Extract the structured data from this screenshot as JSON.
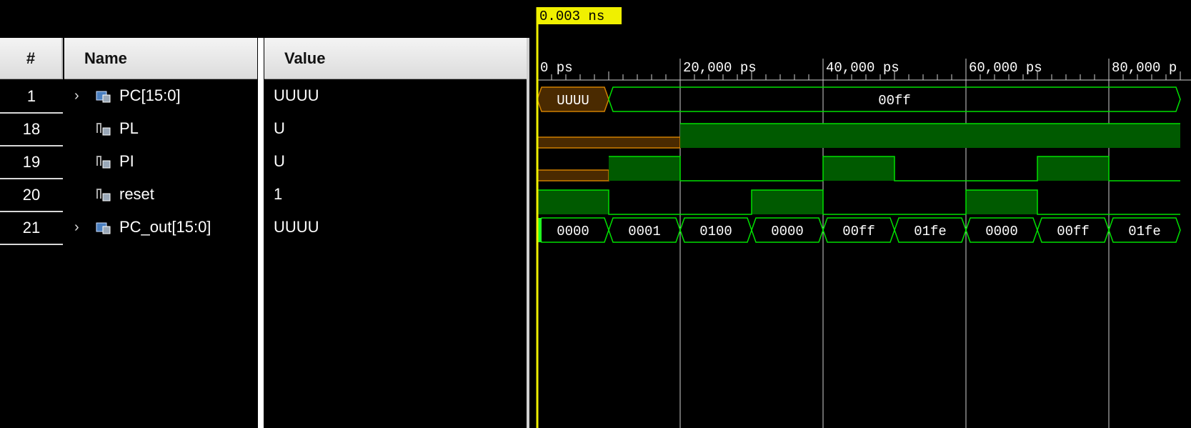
{
  "headers": {
    "num": "#",
    "name": "Name",
    "value": "Value"
  },
  "signals": [
    {
      "num": "1",
      "name": "PC[15:0]",
      "value": "UUUU",
      "expandable": true,
      "icon": "bus-icon"
    },
    {
      "num": "18",
      "name": "PL",
      "value": "U",
      "expandable": false,
      "icon": "signal-icon"
    },
    {
      "num": "19",
      "name": "PI",
      "value": "U",
      "expandable": false,
      "icon": "signal-icon"
    },
    {
      "num": "20",
      "name": "reset",
      "value": "1",
      "expandable": false,
      "icon": "signal-icon"
    },
    {
      "num": "21",
      "name": "PC_out[15:0]",
      "value": "UUUU",
      "expandable": true,
      "icon": "bus-icon"
    }
  ],
  "cursor": {
    "label": "0.003 ns",
    "time_ps": 3
  },
  "timeline": {
    "ticks": [
      "0 ps",
      "20,000 ps",
      "40,000 ps",
      "60,000 ps",
      "80,000 p"
    ],
    "tick_values_ps": [
      0,
      20000,
      40000,
      60000,
      80000
    ]
  },
  "waveforms": {
    "PC": [
      {
        "from": 0,
        "to": 10000,
        "label": "UUUU",
        "undefined": true
      },
      {
        "from": 10000,
        "to": 90000,
        "label": "00ff"
      }
    ],
    "PL": [
      {
        "from": 0,
        "to": 20000,
        "level": "U"
      },
      {
        "from": 20000,
        "to": 90000,
        "level": "1"
      }
    ],
    "PI": [
      {
        "from": 0,
        "to": 10000,
        "level": "U"
      },
      {
        "from": 10000,
        "to": 20000,
        "level": "1"
      },
      {
        "from": 20000,
        "to": 40000,
        "level": "0"
      },
      {
        "from": 40000,
        "to": 50000,
        "level": "1"
      },
      {
        "from": 50000,
        "to": 70000,
        "level": "0"
      },
      {
        "from": 70000,
        "to": 80000,
        "level": "1"
      },
      {
        "from": 80000,
        "to": 90000,
        "level": "0"
      }
    ],
    "reset": [
      {
        "from": 0,
        "to": 10000,
        "level": "1"
      },
      {
        "from": 10000,
        "to": 30000,
        "level": "0"
      },
      {
        "from": 30000,
        "to": 40000,
        "level": "1"
      },
      {
        "from": 40000,
        "to": 60000,
        "level": "0"
      },
      {
        "from": 60000,
        "to": 70000,
        "level": "1"
      },
      {
        "from": 70000,
        "to": 90000,
        "level": "0"
      }
    ],
    "PC_out": [
      {
        "from": 0,
        "to": 10000,
        "label": "0000"
      },
      {
        "from": 10000,
        "to": 20000,
        "label": "0001"
      },
      {
        "from": 20000,
        "to": 30000,
        "label": "0100"
      },
      {
        "from": 30000,
        "to": 40000,
        "label": "0000"
      },
      {
        "from": 40000,
        "to": 50000,
        "label": "00ff"
      },
      {
        "from": 50000,
        "to": 60000,
        "label": "01fe"
      },
      {
        "from": 60000,
        "to": 70000,
        "label": "0000"
      },
      {
        "from": 70000,
        "to": 80000,
        "label": "00ff"
      },
      {
        "from": 80000,
        "to": 90000,
        "label": "01fe"
      }
    ]
  },
  "colors": {
    "wave": "#00e000",
    "wave_fill": "#005a00",
    "undefined": "#d08000",
    "undefined_fill": "#4a2a00",
    "cursor": "#f0f000",
    "grid": "#cfcfcf"
  }
}
